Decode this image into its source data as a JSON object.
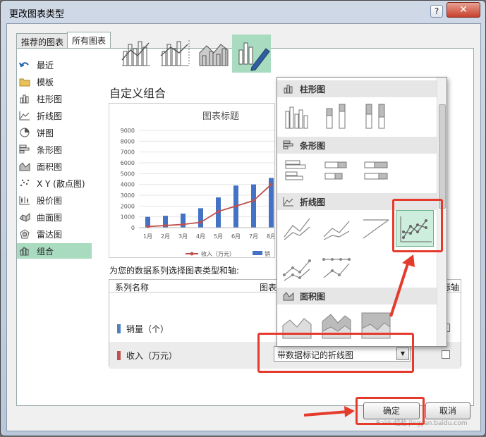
{
  "window": {
    "title": "更改图表类型",
    "help": "?",
    "close": "✕"
  },
  "tabs": [
    {
      "label": "推荐的图表"
    },
    {
      "label": "所有图表"
    }
  ],
  "categories": [
    {
      "label": "最近",
      "icon": "undo-icon"
    },
    {
      "label": "模板",
      "icon": "folder-icon"
    },
    {
      "label": "柱形图",
      "icon": "column-chart-icon"
    },
    {
      "label": "折线图",
      "icon": "line-chart-icon"
    },
    {
      "label": "饼图",
      "icon": "pie-chart-icon"
    },
    {
      "label": "条形图",
      "icon": "bar-chart-icon"
    },
    {
      "label": "面积图",
      "icon": "area-chart-icon"
    },
    {
      "label": "X Y (散点图)",
      "icon": "scatter-chart-icon"
    },
    {
      "label": "股价图",
      "icon": "stock-chart-icon"
    },
    {
      "label": "曲面图",
      "icon": "surface-chart-icon"
    },
    {
      "label": "雷达图",
      "icon": "radar-chart-icon"
    },
    {
      "label": "组合",
      "icon": "combo-chart-icon"
    }
  ],
  "selected_category": "组合",
  "heading": "自定义组合",
  "preview": {
    "title": "图表标题"
  },
  "chart_data": {
    "type": "bar",
    "title": "图表标题",
    "categories": [
      "1月",
      "2月",
      "3月",
      "4月",
      "5月",
      "6月",
      "7月",
      "8月"
    ],
    "ylim": [
      0,
      9000
    ],
    "yticks": [
      0,
      1000,
      2000,
      3000,
      4000,
      5000,
      6000,
      7000,
      8000,
      9000
    ],
    "series": [
      {
        "name": "销量（个）",
        "type": "bar",
        "color": "#4472c4",
        "values": [
          1000,
          1100,
          1300,
          1800,
          2800,
          3900,
          4000,
          4600
        ]
      },
      {
        "name": "收入（万元）",
        "type": "line",
        "color": "#c0504d",
        "values": [
          100,
          200,
          300,
          500,
          1500,
          2000,
          2500,
          4000
        ]
      }
    ],
    "legend": [
      "收入（万元）",
      "销"
    ]
  },
  "series_section": {
    "label": "为您的数据系列选择图表类型和轴:",
    "col_name": "系列名称",
    "col_type": "图表",
    "col_axis": "标轴"
  },
  "series_rows": [
    {
      "name": "销量（个）",
      "color": "#4f81bd"
    },
    {
      "name": "收入（万元）",
      "color": "#c0504d"
    }
  ],
  "dropdown_value": "带数据标记的折线图",
  "popup": {
    "sections": [
      {
        "label": "柱形图"
      },
      {
        "label": "条形图"
      },
      {
        "label": "折线图"
      },
      {
        "label": "面积图"
      }
    ]
  },
  "buttons": {
    "ok": "确定",
    "cancel": "取消"
  },
  "watermark": "Baidu经验 jingyan.baidu.com",
  "colors": {
    "accent": "#a8dbc0",
    "annotation": "#e53b2c"
  }
}
